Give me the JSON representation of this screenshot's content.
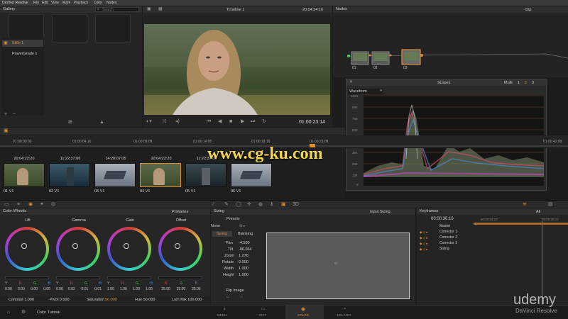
{
  "app": {
    "title": "DaVinci Resolve",
    "menu": [
      "DaVinci Resolve",
      "File",
      "Edit",
      "View",
      "Mark",
      "Playback",
      "Color",
      "Nodes"
    ]
  },
  "gallery": {
    "title": "Gallery",
    "search_placeholder": "Search",
    "items": [
      "Stills 1",
      "PowerGrade 1"
    ]
  },
  "viewer": {
    "timeline_name": "Timeline 1",
    "timecode_top": "20:04:24:16",
    "timecode": "01:00:23:14"
  },
  "nodes": {
    "title": "Nodes",
    "mode": "Clip",
    "labels": [
      "01",
      "02",
      "03"
    ]
  },
  "scopes": {
    "title": "Scopes",
    "type": "Waveform",
    "layout_label": "Multi",
    "page_numbers": [
      "1",
      "2",
      "3"
    ],
    "y_ticks": [
      "1023",
      "896",
      "768",
      "640",
      "512",
      "384",
      "256",
      "128",
      "0"
    ]
  },
  "ruler": {
    "ticks": [
      "01:00:00:00",
      "01:00:04:16",
      "01:00:09:08",
      "01:00:14:00",
      "01:00:18:16",
      "01:00:23:08",
      "01:00:42:08"
    ]
  },
  "clips": [
    {
      "tc": "20:04:22:20",
      "label": "01  V1"
    },
    {
      "tc": "11:22:37:06",
      "label": "02  V1"
    },
    {
      "tc": "14:28:07:05",
      "label": "03  V1"
    },
    {
      "tc": "20:04:22:20",
      "label": "04  V1"
    },
    {
      "tc": "11:22:37:06",
      "label": "05  V1"
    },
    {
      "tc": "",
      "label": "06  V1"
    }
  ],
  "color_wheels": {
    "title": "Color Wheels",
    "mode": "Primaries",
    "wheels": [
      {
        "name": "Lift",
        "labels": [
          "Y",
          "R",
          "G",
          "B"
        ],
        "values": [
          "0.00",
          "0.00",
          "0.00",
          "0.00"
        ]
      },
      {
        "name": "Gamma",
        "labels": [
          "Y",
          "R",
          "G",
          "B"
        ],
        "values": [
          "0.00",
          "0.02",
          "-0.01",
          "-0.01"
        ]
      },
      {
        "name": "Gain",
        "labels": [
          "Y",
          "R",
          "G",
          "B"
        ],
        "values": [
          "1.00",
          "1.00",
          "1.00",
          "1.00"
        ]
      },
      {
        "name": "Offset",
        "labels": [
          "R",
          "G",
          "B"
        ],
        "values": [
          "25.00",
          "25.00",
          "25.00"
        ]
      }
    ],
    "contrast": "Contrast 1.000",
    "pivot": "Pivot 0.500",
    "saturation_label": "Saturation",
    "saturation_value": "50.000",
    "hue": "Hue 50.000",
    "lum_mix": "Lum Mix 100.000"
  },
  "sizing": {
    "title": "Sizing",
    "input_sizing": "Input Sizing",
    "presets_label": "Presets",
    "preset_value": "None",
    "tabs": [
      "Sizing",
      "Blanking"
    ],
    "fields": [
      {
        "label": "Pan",
        "value": "-4.500"
      },
      {
        "label": "Tilt",
        "value": "-86.064"
      },
      {
        "label": "Zoom",
        "value": "1.278"
      },
      {
        "label": "Rotate",
        "value": "0.000"
      },
      {
        "label": "Width",
        "value": "1.000"
      },
      {
        "label": "Height",
        "value": "1.000"
      }
    ],
    "flip_image": "Flip Image"
  },
  "keyframes": {
    "title": "Keyframes",
    "scope": "All",
    "timecode": "00:00:36:16",
    "ruler_start": "00:00:34:20",
    "ruler_end": "00:00:36:17",
    "tracks": [
      "Master",
      "Corrector 1",
      "Corrector 2",
      "Corrector 3",
      "Sizing"
    ]
  },
  "status": {
    "project": "Color Tutorial"
  },
  "pages": [
    {
      "label": "MEDIA",
      "icon": "media-icon"
    },
    {
      "label": "EDIT",
      "icon": "edit-icon"
    },
    {
      "label": "COLOR",
      "icon": "color-icon"
    },
    {
      "label": "DELIVER",
      "icon": "deliver-icon"
    }
  ],
  "watermarks": {
    "site": "www.cg-ku.com",
    "udemy": "udemy",
    "resolve": "DaVinci Resolve"
  }
}
